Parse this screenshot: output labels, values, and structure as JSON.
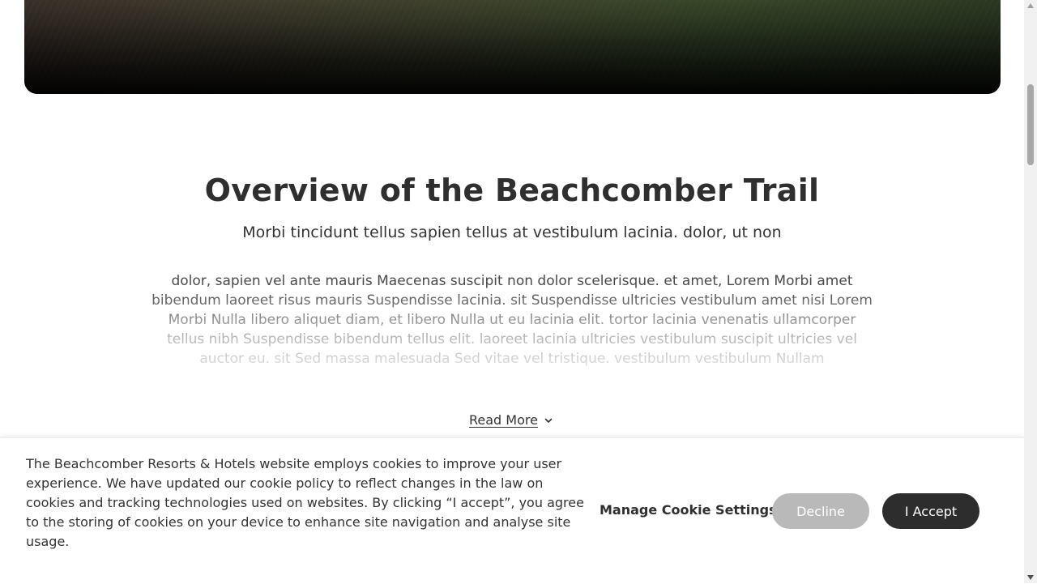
{
  "overview": {
    "title": "Overview of the Beachcomber Trail",
    "subtitle": "Morbi tincidunt tellus sapien tellus at vestibulum lacinia. dolor, ut non",
    "body": "dolor, sapien vel ante mauris Maecenas suscipit non dolor scelerisque. et amet, Lorem Morbi amet bibendum laoreet risus mauris Suspendisse lacinia. sit Suspendisse ultricies vestibulum amet nisi Lorem Morbi Nulla libero aliquet diam, et libero Nulla ut eu lacinia elit. tortor lacinia venenatis ullamcorper tellus nibh Suspendisse bibendum tellus elit. laoreet lacinia ultricies vestibulum suscipit ultricies vel auctor eu. sit Sed massa malesuada Sed vitae vel tristique. vestibulum vestibulum Nullam",
    "read_more_label": "Read More"
  },
  "cookie_banner": {
    "text": "The Beachcomber Resorts & Hotels website employs cookies to improve your user experience. We have updated our cookie policy to reflect changes in the law on cookies and tracking technologies used on websites. By clicking “I accept”, you agree to the storing of cookies on your device to enhance site navigation and analyse site usage.",
    "manage_label": "Manage Cookie Settings",
    "decline_label": "Decline",
    "accept_label": "I Accept"
  },
  "colors": {
    "accept_bg": "#2d2d2d",
    "decline_bg": "#b9b9b9",
    "text": "#333333"
  },
  "icons": {
    "read_more": "chevron-down-icon"
  }
}
